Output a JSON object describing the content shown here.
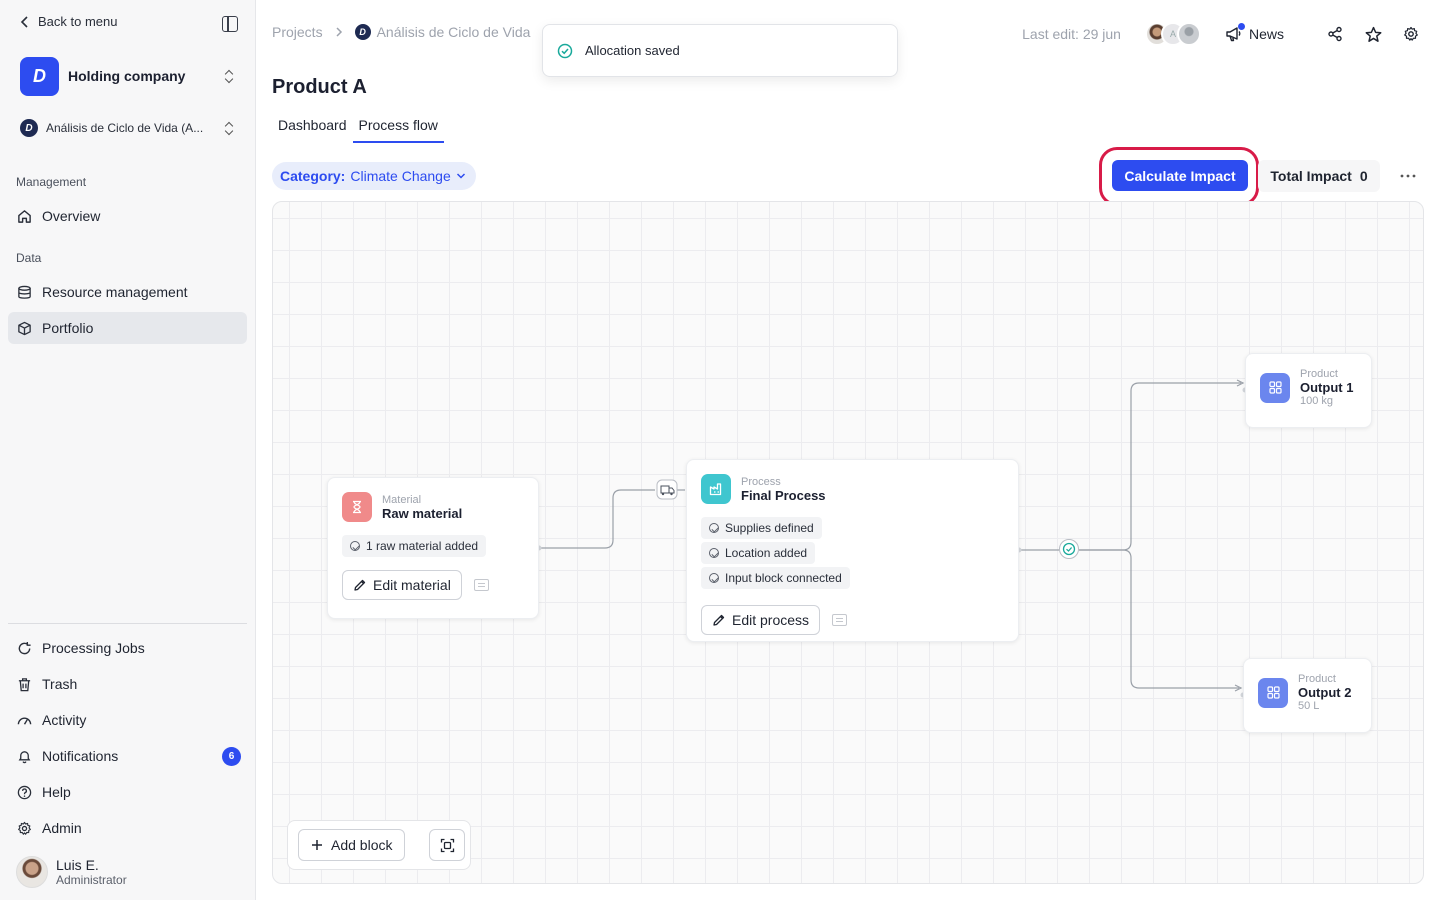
{
  "sidebar": {
    "back_label": "Back to menu",
    "company": "Holding company",
    "company_logo": "D",
    "project": "Análisis de Ciclo de Vida (A...",
    "management_label": "Management",
    "data_label": "Data",
    "items": [
      {
        "label": "Overview",
        "icon": "home-icon"
      },
      {
        "label": "Resource management",
        "icon": "database-icon"
      },
      {
        "label": "Portfolio",
        "icon": "box-icon"
      }
    ],
    "bottom_items": [
      {
        "label": "Processing Jobs",
        "icon": "refresh-icon"
      },
      {
        "label": "Trash",
        "icon": "trash-icon"
      },
      {
        "label": "Activity",
        "icon": "gauge-icon"
      },
      {
        "label": "Notifications",
        "icon": "bell-icon",
        "badge": "6"
      },
      {
        "label": "Help",
        "icon": "help-icon"
      },
      {
        "label": "Admin",
        "icon": "gear-icon"
      }
    ],
    "user": {
      "name": "Luis E.",
      "role": "Administrator"
    }
  },
  "topbar": {
    "breadcrumb_projects": "Projects",
    "breadcrumb_project": "Análisis de Ciclo de Vida",
    "last_edit": "Last edit: 29 jun",
    "avatar_initial": "A",
    "news": "News"
  },
  "toast": {
    "message": "Allocation saved"
  },
  "page": {
    "title": "Product A",
    "tabs": [
      "Dashboard",
      "Process flow"
    ],
    "active_tab": "Process flow",
    "category_label": "Category:",
    "category_value": "Climate Change",
    "calculate_label": "Calculate Impact",
    "total_label": "Total Impact",
    "total_value": "0"
  },
  "flow": {
    "material": {
      "type": "Material",
      "title": "Raw material",
      "chips": [
        "1 raw material added"
      ],
      "edit_label": "Edit material"
    },
    "process": {
      "type": "Process",
      "title": "Final Process",
      "chips": [
        "Supplies defined",
        "Location added",
        "Input block connected"
      ],
      "edit_label": "Edit process"
    },
    "outputs": [
      {
        "type": "Product",
        "title": "Output 1",
        "amount": "100 kg"
      },
      {
        "type": "Product",
        "title": "Output 2",
        "amount": "50 L"
      }
    ],
    "add_block_label": "Add block"
  },
  "colors": {
    "accent": "#2d4cf0",
    "highlight_ring": "#d81b48",
    "material_icon_bg": "#f08a8a",
    "process_icon_bg": "#3fc6cf",
    "product_icon_bg": "#6b86ee"
  }
}
